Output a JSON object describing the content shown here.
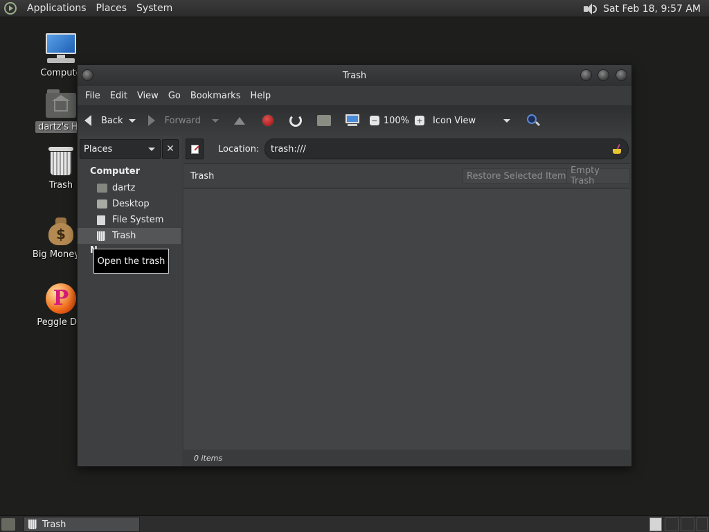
{
  "top_panel": {
    "menus": [
      "Applications",
      "Places",
      "System"
    ],
    "clock": "Sat Feb 18,  9:57 AM",
    "volume_icon": "speaker-icon"
  },
  "desktop": {
    "icons": [
      {
        "label": "Compute",
        "icon": "computer-icon"
      },
      {
        "label": "dartz's Ho",
        "icon": "home-folder-icon"
      },
      {
        "label": "Trash",
        "icon": "trash-icon"
      },
      {
        "label": "Big Money D",
        "icon": "money-bag-icon"
      },
      {
        "label": "Peggle Del",
        "icon": "peggle-icon"
      }
    ]
  },
  "window": {
    "title": "Trash",
    "menu": [
      "File",
      "Edit",
      "View",
      "Go",
      "Bookmarks",
      "Help"
    ],
    "toolbar": {
      "back": "Back",
      "forward": "Forward",
      "zoom": "100%",
      "view_mode": "Icon View"
    },
    "sidebar": {
      "selector": "Places",
      "close": "✕",
      "section": "Computer",
      "items": [
        "dartz",
        "Desktop",
        "File System",
        "Trash"
      ],
      "network_peek": "N",
      "tooltip": "Open the trash"
    },
    "location": {
      "label": "Location:",
      "value": "trash:///"
    },
    "trash_bar": {
      "title": "Trash",
      "restore": "Restore Selected Items",
      "empty": "Empty Trash"
    },
    "status": "0 items"
  },
  "bottom_panel": {
    "task": "Trash"
  },
  "colors": {
    "desktop_bg": "#1e1f1d",
    "window_bg": "#3b3c3e",
    "content_bg": "#434446",
    "stop_red": "#c02020",
    "search_blue": "#5b8ad8"
  }
}
